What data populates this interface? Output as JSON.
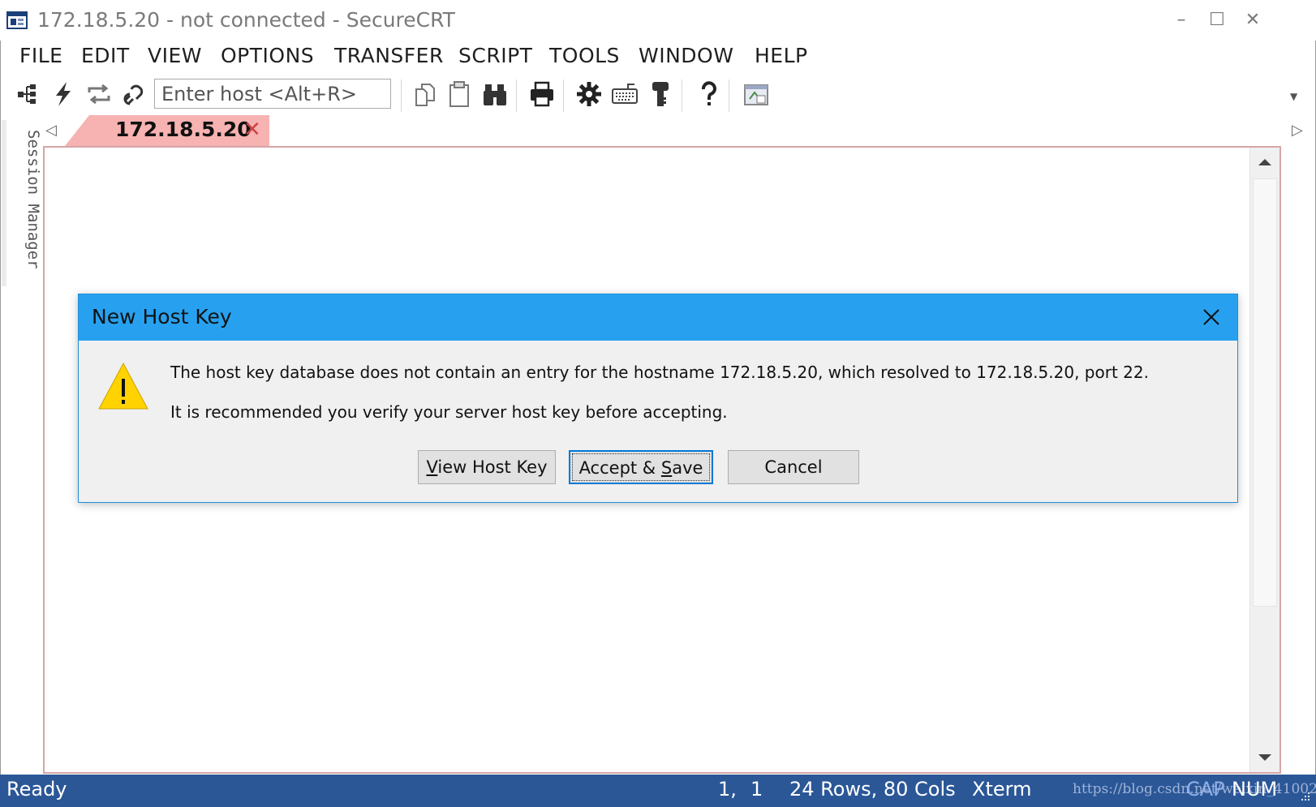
{
  "window": {
    "title": "172.18.5.20 - not connected - SecureCRT",
    "controls": {
      "minimize": "–",
      "maximize": "☐",
      "close": "✕"
    }
  },
  "menu": [
    "FILE",
    "EDIT",
    "VIEW",
    "OPTIONS",
    "TRANSFER",
    "SCRIPT",
    "TOOLS",
    "WINDOW",
    "HELP"
  ],
  "toolbar": {
    "host_placeholder": "Enter host <Alt+R>",
    "icons": [
      "connect-icon",
      "quick-connect-icon",
      "reconnect-icon",
      "disconnect-icon",
      "copy-icon",
      "paste-icon",
      "find-icon",
      "print-icon",
      "options-icon",
      "keymap-icon",
      "key-icon",
      "help-icon",
      "sftp-icon"
    ]
  },
  "session_manager": {
    "label": "Session Manager"
  },
  "tabs": [
    {
      "label": "172.18.5.20",
      "close": "✕"
    }
  ],
  "dialog": {
    "title": "New Host Key",
    "message_line1": "The host key database does not contain an entry for the hostname 172.18.5.20, which resolved to 172.18.5.20, port 22.",
    "message_line2": "It is recommended you verify your server host key before accepting.",
    "buttons": {
      "view": {
        "pre": "",
        "mnemonic": "V",
        "post": "iew Host Key"
      },
      "accept": {
        "pre": "Accept & ",
        "mnemonic": "S",
        "post": "ave"
      },
      "cancel": "Cancel"
    }
  },
  "status": {
    "ready": "Ready",
    "cursor_row": "1,",
    "cursor_col": "1",
    "size": "24 Rows, 80 Cols",
    "emulation": "Xterm",
    "watermark": "https://blog.csdn.net/weixin_41002",
    "cap": "CAP",
    "num": "NUM"
  },
  "colors": {
    "dialog_title_bar": "#27a1ef",
    "status_bar": "#2b5797",
    "tab_active": "#f7b2b2",
    "warning": "#ffd200"
  }
}
